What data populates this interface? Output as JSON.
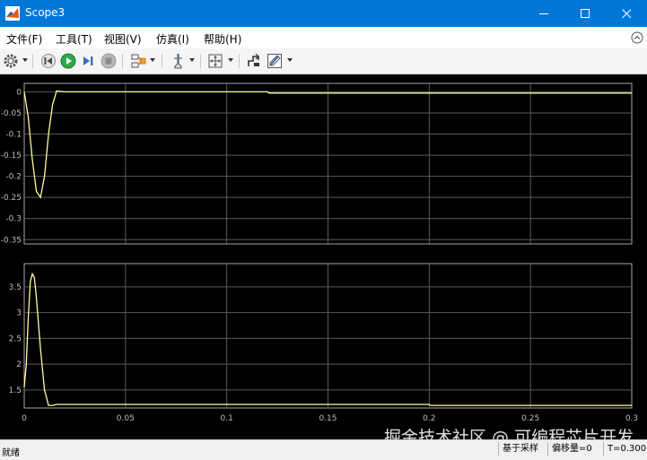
{
  "window": {
    "title": "Scope3",
    "controls": [
      "minimize-icon",
      "maximize-icon",
      "close-icon"
    ]
  },
  "menu": {
    "items": [
      "文件(F)",
      "工具(T)",
      "视图(V)",
      "仿真(I)",
      "帮助(H)"
    ]
  },
  "toolbar": {
    "buttons": [
      "gear-icon",
      "step-back-icon",
      "run-icon",
      "step-forward-icon",
      "stop-icon",
      "highlight-icon",
      "cursor-measure-icon",
      "zoom-fit-icon",
      "scale-icon",
      "style-icon"
    ]
  },
  "colors": {
    "titlebar": "#0078d7",
    "trace": "#ffff99",
    "axes_background": "#000000",
    "grid": "#5a5a5a"
  },
  "chart_data": [
    {
      "type": "line",
      "x_ticks": [
        "0",
        "0.05",
        "0.1",
        "0.15",
        "0.2",
        "0.25",
        "0.3"
      ],
      "y_ticks": [
        "0",
        "-0.05",
        "-0.1",
        "-0.15",
        "-0.2",
        "-0.25",
        "-0.3",
        "-0.35"
      ],
      "xlim": [
        0,
        0.3
      ],
      "ylim": [
        -0.36,
        0.02
      ],
      "grid": true,
      "series": [
        {
          "x": [
            0,
            0.002,
            0.004,
            0.006,
            0.008,
            0.01,
            0.012,
            0.014,
            0.016,
            0.02,
            0.05,
            0.1,
            0.12,
            0.121,
            0.15,
            0.2,
            0.25,
            0.3
          ],
          "y": [
            0,
            -0.06,
            -0.16,
            -0.235,
            -0.25,
            -0.2,
            -0.1,
            -0.03,
            0.002,
            0,
            0,
            0,
            0,
            -0.003,
            -0.003,
            -0.003,
            -0.003,
            -0.003
          ]
        }
      ]
    },
    {
      "type": "line",
      "x_ticks": [
        "0",
        "0.05",
        "0.1",
        "0.15",
        "0.2",
        "0.25",
        "0.3"
      ],
      "y_ticks": [
        "1.5",
        "2",
        "2.5",
        "3",
        "3.5"
      ],
      "xlim": [
        0,
        0.3
      ],
      "ylim": [
        1.15,
        3.95
      ],
      "grid": true,
      "series": [
        {
          "x": [
            0,
            0.001,
            0.002,
            0.003,
            0.004,
            0.005,
            0.006,
            0.008,
            0.01,
            0.012,
            0.014,
            0.016,
            0.02,
            0.05,
            0.1,
            0.15,
            0.2,
            0.2005,
            0.25,
            0.3
          ],
          "y": [
            1.55,
            2.0,
            2.9,
            3.6,
            3.75,
            3.68,
            3.3,
            2.3,
            1.5,
            1.2,
            1.2,
            1.22,
            1.22,
            1.22,
            1.22,
            1.22,
            1.22,
            1.2,
            1.2,
            1.2
          ]
        }
      ]
    }
  ],
  "status": {
    "ready": "就绪",
    "cells": [
      "基于采样",
      "偏移量=0",
      "T=0.300"
    ]
  },
  "watermark": "掘金技术社区 @ 可编程芯片开发"
}
